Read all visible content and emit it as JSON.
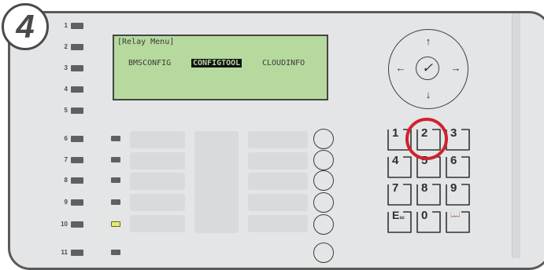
{
  "step": {
    "number": "4"
  },
  "lcd": {
    "title": "[Relay Menu]",
    "options": [
      "BMSCONFIG",
      "CONFIGTOOL",
      "CLOUDINFO"
    ],
    "selected_index": 1
  },
  "leds": {
    "numbers": [
      "1",
      "2",
      "3",
      "4",
      "5",
      "6",
      "7",
      "8",
      "9",
      "10",
      "11"
    ],
    "lit_zone_row": "10"
  },
  "nav": {
    "up": "↑",
    "down": "↓",
    "left": "←",
    "right": "→",
    "center": "✓"
  },
  "keypad": {
    "keys": [
      "1",
      "2",
      "3",
      "4",
      "5",
      "6",
      "7",
      "8",
      "9",
      "E",
      "0",
      "📖"
    ],
    "esc_sub": "sc",
    "highlighted_key": "2"
  },
  "colors": {
    "lcd_bg": "#b6d99e",
    "highlight": "#d0222e",
    "lit_led": "#e8ea6a",
    "panel": "#e4e5e6"
  }
}
